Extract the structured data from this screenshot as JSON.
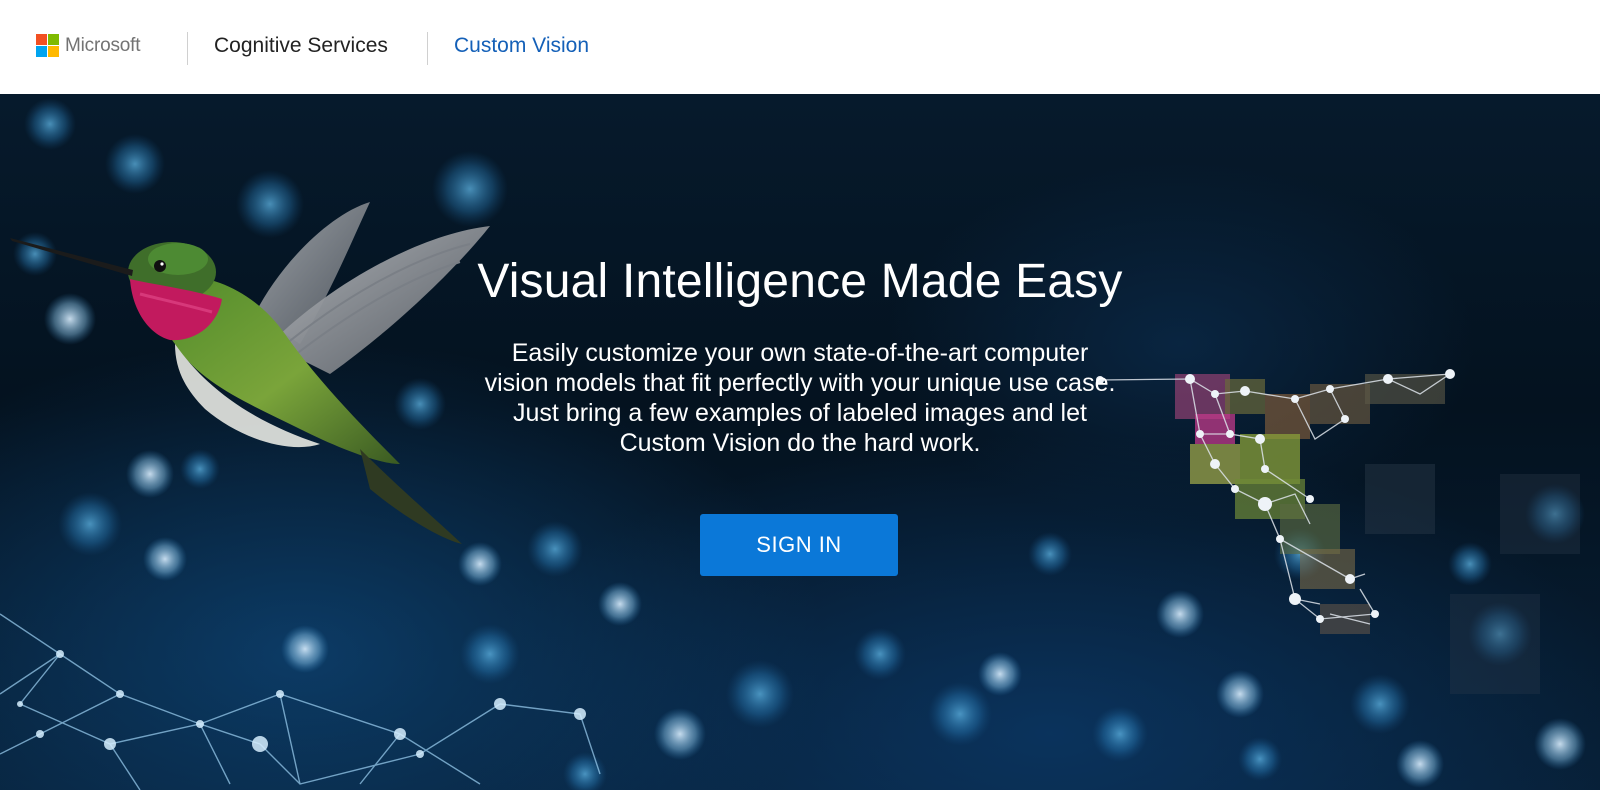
{
  "header": {
    "brand": {
      "name": "Microsoft",
      "logo_colors": [
        "#f25022",
        "#7fba00",
        "#00a4ef",
        "#ffb900"
      ]
    },
    "nav": [
      {
        "label": "Cognitive Services"
      },
      {
        "label": "Custom Vision",
        "color": "#1460b8"
      }
    ]
  },
  "hero": {
    "title": "Visual Intelligence Made Easy",
    "description": "Easily customize your own state-of-the-art computer vision models that fit perfectly with your unique use case. Just bring a few examples of labeled images and let Custom Vision do the hard work.",
    "signin_label": "SIGN IN",
    "button_color": "#0b78d8"
  },
  "images": {
    "left": "hummingbird-photo",
    "right": "pixelated-hummingbird-graph"
  }
}
